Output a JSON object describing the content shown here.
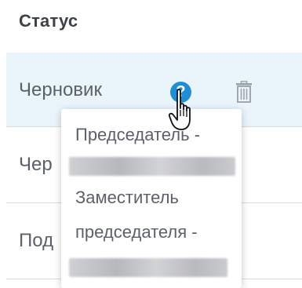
{
  "table": {
    "column_header": "Статус",
    "rows": [
      {
        "status": "Черновик"
      },
      {
        "status": "Чер"
      },
      {
        "status": "Под"
      }
    ]
  },
  "tooltip": {
    "line1": "Председатель -",
    "line3": "Заместитель",
    "line4": "председателя -"
  },
  "icons": {
    "help": "question-circle-icon",
    "help_glyph": "?",
    "delete": "trash-icon",
    "cursor": "hand-pointer-cursor"
  },
  "colors": {
    "accent_blue": "#1e8fd6",
    "selected_row_bg": "#eaf4fb",
    "text": "#5b6069"
  }
}
